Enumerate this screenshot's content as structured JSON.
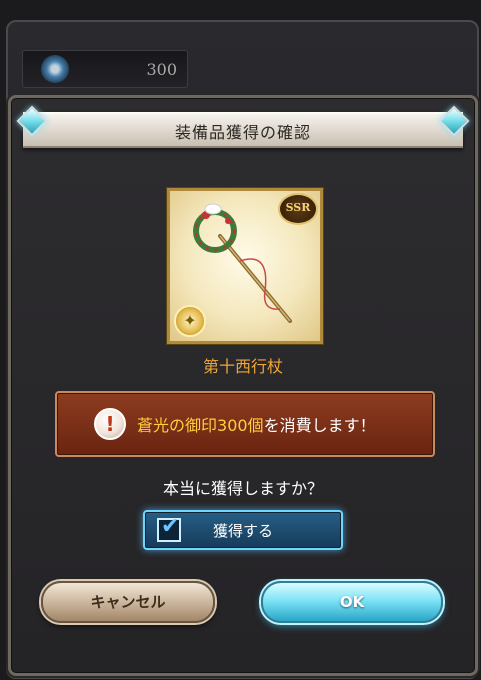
{
  "background": {
    "currency_value": "300",
    "currency_icon": "crest-icon"
  },
  "dialog": {
    "title": "装備品獲得の確認",
    "item": {
      "name": "第十西行杖",
      "rarity": "SSR",
      "element_icon": "light-element-icon"
    },
    "warning": {
      "icon": "exclamation-icon",
      "prefix": "蒼光の御印",
      "amount": "300個",
      "suffix": "を消費します！"
    },
    "question": "本当に獲得しますか？",
    "acquire_toggle": {
      "label": "獲得する",
      "checked": true
    },
    "buttons": {
      "cancel": "キャンセル",
      "ok": "OK"
    }
  },
  "colors": {
    "item_name": "#f1a63a",
    "warning_bg": "#7a2e16",
    "warning_highlight": "#ffcf3d",
    "ok_button": "#7fe4f6"
  }
}
